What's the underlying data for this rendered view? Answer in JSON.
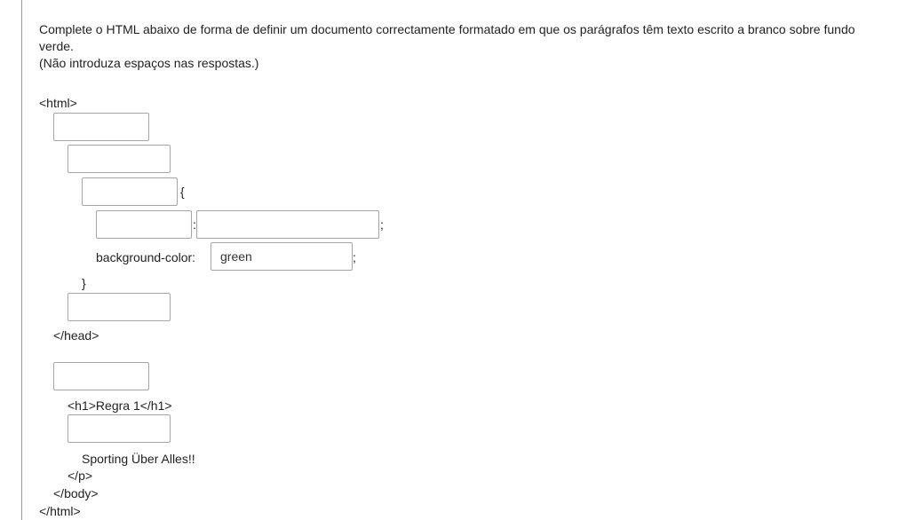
{
  "question": {
    "line1": "Complete o HTML abaixo de forma de definir um documento correctamente formatado em que os parágrafos têm texto escrito a branco sobre fundo verde.",
    "line2": "(Não introduza espaços nas respostas.)"
  },
  "code": {
    "html_open": "<html>",
    "brace_open": "{",
    "colon": ":",
    "semicolon1": ";",
    "bg_label": "background-color:",
    "semicolon2": ";",
    "brace_close": "}",
    "head_close": "</head>",
    "h1_line": "<h1>Regra 1</h1>",
    "paragraph_text": "Sporting Über Alles!!",
    "p_close": "</p>",
    "body_close": "</body>",
    "html_close": "</html>"
  },
  "answers": {
    "blank1": "",
    "blank2": "",
    "blank3": "",
    "blank4": "",
    "blank5": "",
    "bg_value": "green",
    "blank6": "",
    "blank7": "",
    "blank8": ""
  }
}
